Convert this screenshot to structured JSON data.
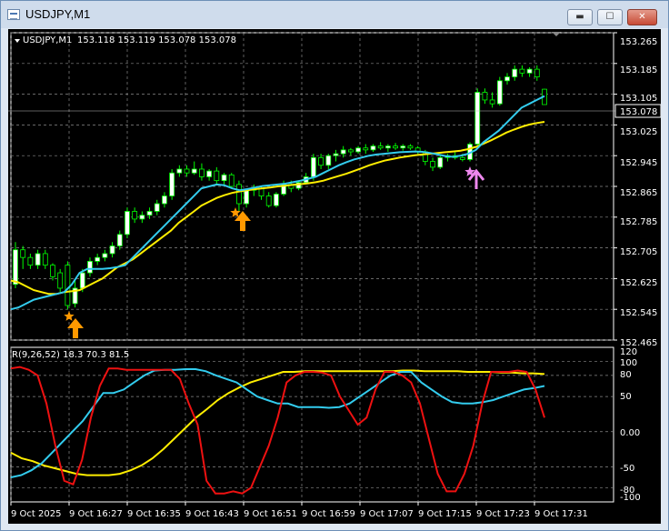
{
  "window": {
    "title": "USDJPY,M1",
    "min_label": "▬",
    "max_label": "☐",
    "close_label": "✕"
  },
  "colors": {
    "background": "#000000",
    "grid": "#8a8a8a",
    "bull_candle": "#ffffff",
    "bear_candle": "#000000",
    "wick": "#00ff00",
    "ma_fast": "#33ccee",
    "ma_slow": "#ffee00",
    "osc_red": "#ee1111",
    "osc_cyan": "#33ccee",
    "osc_yellow": "#ffee00",
    "arrow_orange": "#ff9900",
    "arrow_violet": "#ee88ee",
    "price_tag_border": "#ffffff"
  },
  "main": {
    "symbol_info": "USDJPY,M1",
    "ohlc": "153.118 153.119 153.078 153.078",
    "price_axis_labels": [
      "153.265",
      "153.185",
      "153.105",
      "153.025",
      "152.945",
      "152.865",
      "152.785",
      "152.705",
      "152.625",
      "152.545",
      "152.465"
    ],
    "current_price": "153.078"
  },
  "oscillator": {
    "label": "R(9,26,52) 18.3 70.3 81.5",
    "axis_labels": [
      "120",
      "100",
      "80",
      "50",
      "0.00",
      "-50",
      "-80",
      "-100"
    ]
  },
  "time_axis": [
    "9 Oct 2025",
    "9 Oct 16:27",
    "9 Oct 16:35",
    "9 Oct 16:43",
    "9 Oct 16:51",
    "9 Oct 16:59",
    "9 Oct 17:07",
    "9 Oct 17:15",
    "9 Oct 17:23",
    "9 Oct 17:31"
  ],
  "chart_data": {
    "type": "candlestick",
    "symbol": "USDJPY",
    "timeframe": "M1",
    "price_range": [
      152.465,
      153.265
    ],
    "candles": [
      {
        "o": 152.61,
        "h": 152.72,
        "l": 152.6,
        "c": 152.7
      },
      {
        "o": 152.7,
        "h": 152.71,
        "l": 152.65,
        "c": 152.68
      },
      {
        "o": 152.68,
        "h": 152.69,
        "l": 152.65,
        "c": 152.66
      },
      {
        "o": 152.66,
        "h": 152.7,
        "l": 152.65,
        "c": 152.69
      },
      {
        "o": 152.69,
        "h": 152.7,
        "l": 152.65,
        "c": 152.66
      },
      {
        "o": 152.66,
        "h": 152.665,
        "l": 152.62,
        "c": 152.63
      },
      {
        "o": 152.64,
        "h": 152.65,
        "l": 152.59,
        "c": 152.6
      },
      {
        "o": 152.66,
        "h": 152.67,
        "l": 152.545,
        "c": 152.555
      },
      {
        "o": 152.56,
        "h": 152.62,
        "l": 152.55,
        "c": 152.6
      },
      {
        "o": 152.6,
        "h": 152.65,
        "l": 152.59,
        "c": 152.64
      },
      {
        "o": 152.64,
        "h": 152.68,
        "l": 152.63,
        "c": 152.67
      },
      {
        "o": 152.67,
        "h": 152.69,
        "l": 152.66,
        "c": 152.68
      },
      {
        "o": 152.68,
        "h": 152.7,
        "l": 152.67,
        "c": 152.69
      },
      {
        "o": 152.69,
        "h": 152.72,
        "l": 152.68,
        "c": 152.71
      },
      {
        "o": 152.71,
        "h": 152.75,
        "l": 152.7,
        "c": 152.74
      },
      {
        "o": 152.74,
        "h": 152.81,
        "l": 152.73,
        "c": 152.8
      },
      {
        "o": 152.8,
        "h": 152.81,
        "l": 152.77,
        "c": 152.78
      },
      {
        "o": 152.78,
        "h": 152.8,
        "l": 152.77,
        "c": 152.79
      },
      {
        "o": 152.79,
        "h": 152.81,
        "l": 152.78,
        "c": 152.8
      },
      {
        "o": 152.8,
        "h": 152.83,
        "l": 152.79,
        "c": 152.82
      },
      {
        "o": 152.82,
        "h": 152.85,
        "l": 152.81,
        "c": 152.84
      },
      {
        "o": 152.84,
        "h": 152.91,
        "l": 152.83,
        "c": 152.9
      },
      {
        "o": 152.9,
        "h": 152.92,
        "l": 152.89,
        "c": 152.91
      },
      {
        "o": 152.91,
        "h": 152.92,
        "l": 152.89,
        "c": 152.9
      },
      {
        "o": 152.9,
        "h": 152.93,
        "l": 152.895,
        "c": 152.91
      },
      {
        "o": 152.91,
        "h": 152.925,
        "l": 152.88,
        "c": 152.89
      },
      {
        "o": 152.89,
        "h": 152.91,
        "l": 152.88,
        "c": 152.905
      },
      {
        "o": 152.905,
        "h": 152.915,
        "l": 152.87,
        "c": 152.88
      },
      {
        "o": 152.88,
        "h": 152.9,
        "l": 152.87,
        "c": 152.895
      },
      {
        "o": 152.895,
        "h": 152.9,
        "l": 152.86,
        "c": 152.865
      },
      {
        "o": 152.87,
        "h": 152.88,
        "l": 152.8,
        "c": 152.82
      },
      {
        "o": 152.82,
        "h": 152.86,
        "l": 152.81,
        "c": 152.855
      },
      {
        "o": 152.855,
        "h": 152.87,
        "l": 152.84,
        "c": 152.86
      },
      {
        "o": 152.86,
        "h": 152.865,
        "l": 152.83,
        "c": 152.84
      },
      {
        "o": 152.84,
        "h": 152.85,
        "l": 152.81,
        "c": 152.815
      },
      {
        "o": 152.815,
        "h": 152.85,
        "l": 152.81,
        "c": 152.845
      },
      {
        "o": 152.845,
        "h": 152.88,
        "l": 152.84,
        "c": 152.87
      },
      {
        "o": 152.87,
        "h": 152.88,
        "l": 152.85,
        "c": 152.86
      },
      {
        "o": 152.86,
        "h": 152.88,
        "l": 152.855,
        "c": 152.875
      },
      {
        "o": 152.875,
        "h": 152.9,
        "l": 152.87,
        "c": 152.89
      },
      {
        "o": 152.89,
        "h": 152.95,
        "l": 152.88,
        "c": 152.94
      },
      {
        "o": 152.94,
        "h": 152.95,
        "l": 152.91,
        "c": 152.92
      },
      {
        "o": 152.92,
        "h": 152.95,
        "l": 152.91,
        "c": 152.945
      },
      {
        "o": 152.945,
        "h": 152.96,
        "l": 152.93,
        "c": 152.95
      },
      {
        "o": 152.95,
        "h": 152.97,
        "l": 152.94,
        "c": 152.96
      },
      {
        "o": 152.96,
        "h": 152.965,
        "l": 152.945,
        "c": 152.955
      },
      {
        "o": 152.955,
        "h": 152.97,
        "l": 152.95,
        "c": 152.965
      },
      {
        "o": 152.965,
        "h": 152.975,
        "l": 152.95,
        "c": 152.96
      },
      {
        "o": 152.96,
        "h": 152.975,
        "l": 152.955,
        "c": 152.97
      },
      {
        "o": 152.97,
        "h": 152.98,
        "l": 152.96,
        "c": 152.965
      },
      {
        "o": 152.965,
        "h": 152.975,
        "l": 152.955,
        "c": 152.97
      },
      {
        "o": 152.97,
        "h": 152.978,
        "l": 152.96,
        "c": 152.965
      },
      {
        "o": 152.965,
        "h": 152.975,
        "l": 152.958,
        "c": 152.97
      },
      {
        "o": 152.97,
        "h": 152.975,
        "l": 152.96,
        "c": 152.965
      },
      {
        "o": 152.965,
        "h": 152.97,
        "l": 152.95,
        "c": 152.955
      },
      {
        "o": 152.955,
        "h": 152.96,
        "l": 152.92,
        "c": 152.93
      },
      {
        "o": 152.93,
        "h": 152.94,
        "l": 152.905,
        "c": 152.915
      },
      {
        "o": 152.915,
        "h": 152.945,
        "l": 152.91,
        "c": 152.94
      },
      {
        "o": 152.94,
        "h": 152.95,
        "l": 152.93,
        "c": 152.945
      },
      {
        "o": 152.945,
        "h": 152.955,
        "l": 152.935,
        "c": 152.94
      },
      {
        "o": 152.94,
        "h": 152.95,
        "l": 152.93,
        "c": 152.935
      },
      {
        "o": 152.935,
        "h": 152.98,
        "l": 152.93,
        "c": 152.975
      },
      {
        "o": 152.975,
        "h": 153.12,
        "l": 152.97,
        "c": 153.11
      },
      {
        "o": 153.11,
        "h": 153.12,
        "l": 153.08,
        "c": 153.09
      },
      {
        "o": 153.09,
        "h": 153.11,
        "l": 153.07,
        "c": 153.08
      },
      {
        "o": 153.08,
        "h": 153.15,
        "l": 153.075,
        "c": 153.14
      },
      {
        "o": 153.14,
        "h": 153.16,
        "l": 153.13,
        "c": 153.15
      },
      {
        "o": 153.15,
        "h": 153.18,
        "l": 153.14,
        "c": 153.17
      },
      {
        "o": 153.17,
        "h": 153.18,
        "l": 153.15,
        "c": 153.16
      },
      {
        "o": 153.16,
        "h": 153.175,
        "l": 153.15,
        "c": 153.17
      },
      {
        "o": 153.17,
        "h": 153.18,
        "l": 153.14,
        "c": 153.15
      },
      {
        "o": 153.118,
        "h": 153.119,
        "l": 153.078,
        "c": 153.078
      }
    ],
    "ma_fast": [
      152.545,
      152.55,
      152.56,
      152.57,
      152.575,
      152.58,
      152.585,
      152.59,
      152.61,
      152.64,
      152.65,
      152.65,
      152.65,
      152.652,
      152.655,
      152.66,
      152.68,
      152.7,
      152.72,
      152.74,
      152.76,
      152.78,
      152.8,
      152.82,
      152.84,
      152.86,
      152.865,
      152.87,
      152.868,
      152.86,
      152.855,
      152.858,
      152.862,
      152.866,
      152.868,
      152.87,
      152.872,
      152.876,
      152.88,
      152.885,
      152.89,
      152.9,
      152.91,
      152.92,
      152.928,
      152.935,
      152.94,
      152.945,
      152.948,
      152.95,
      152.952,
      152.954,
      152.955,
      152.956,
      152.955,
      152.952,
      152.948,
      152.944,
      152.942,
      152.945,
      152.95,
      152.96,
      152.98,
      152.995,
      153.01,
      153.03,
      153.05,
      153.07,
      153.08,
      153.09,
      153.1
    ],
    "ma_slow": [
      152.62,
      152.615,
      152.605,
      152.595,
      152.59,
      152.585,
      152.585,
      152.59,
      152.592,
      152.595,
      152.605,
      152.615,
      152.625,
      152.64,
      152.655,
      152.665,
      152.675,
      152.69,
      152.705,
      152.72,
      152.735,
      152.75,
      152.77,
      152.785,
      152.8,
      152.815,
      152.825,
      152.835,
      152.842,
      152.848,
      152.852,
      152.855,
      152.858,
      152.86,
      152.862,
      152.865,
      152.867,
      152.869,
      152.871,
      152.873,
      152.876,
      152.88,
      152.886,
      152.892,
      152.898,
      152.905,
      152.912,
      152.92,
      152.926,
      152.932,
      152.936,
      152.94,
      152.943,
      152.946,
      152.948,
      152.95,
      152.952,
      152.954,
      152.956,
      152.958,
      152.962,
      152.968,
      152.976,
      152.985,
      152.995,
      153.005,
      153.013,
      153.02,
      153.026,
      153.03,
      153.033
    ],
    "oscillator_range": [
      -100,
      120
    ],
    "osc_red": [
      90,
      92,
      88,
      80,
      40,
      -20,
      -70,
      -75,
      -40,
      20,
      65,
      90,
      90,
      88,
      88,
      88,
      88,
      88,
      88,
      75,
      40,
      10,
      -70,
      -88,
      -88,
      -85,
      -88,
      -80,
      -50,
      -20,
      20,
      70,
      80,
      85,
      85,
      84,
      80,
      50,
      30,
      10,
      20,
      60,
      85,
      85,
      80,
      70,
      40,
      -10,
      -60,
      -85,
      -85,
      -60,
      -20,
      40,
      85,
      85,
      85,
      87,
      85,
      60,
      20
    ],
    "osc_cyan": [
      -65,
      -62,
      -55,
      -45,
      -30,
      -15,
      0,
      15,
      35,
      55,
      55,
      60,
      70,
      80,
      87,
      88,
      88,
      89,
      89,
      86,
      80,
      75,
      70,
      60,
      50,
      45,
      40,
      40,
      35,
      35,
      35,
      34,
      35,
      40,
      50,
      60,
      70,
      80,
      85,
      85,
      70,
      60,
      50,
      42,
      40,
      40,
      42,
      45,
      50,
      55,
      60,
      62,
      65
    ],
    "osc_yellow": [
      -30,
      -38,
      -42,
      -48,
      -52,
      -56,
      -60,
      -62,
      -62,
      -62,
      -60,
      -55,
      -48,
      -38,
      -25,
      -10,
      5,
      20,
      32,
      45,
      55,
      63,
      70,
      75,
      80,
      85,
      85,
      86,
      86,
      86,
      86,
      86,
      86,
      86,
      86,
      86,
      87,
      87,
      86,
      86,
      86,
      86,
      85,
      85,
      85,
      84,
      84,
      83,
      83,
      82
    ]
  }
}
